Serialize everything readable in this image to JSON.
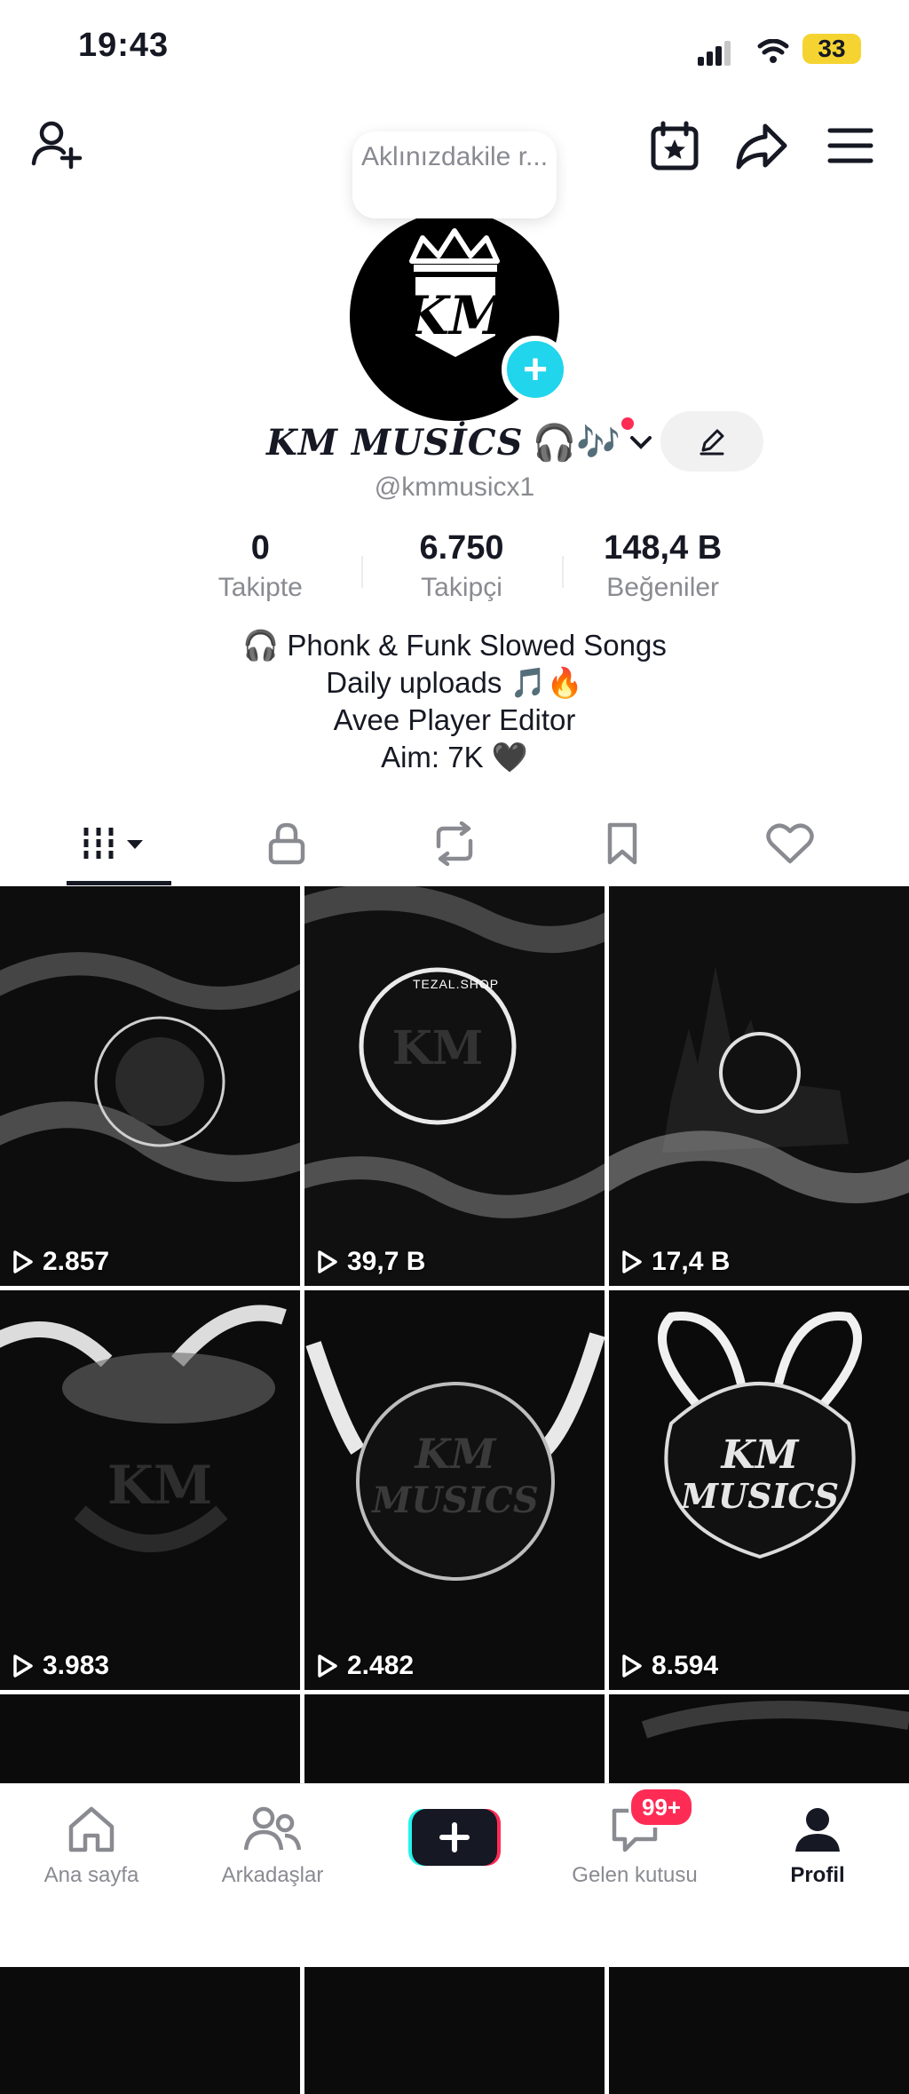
{
  "status_bar": {
    "time": "19:43",
    "battery": "33"
  },
  "bubble": {
    "text": "Aklınızdakile r..."
  },
  "profile": {
    "display_name": "KM MUSİCS",
    "name_emoji": "🎧🎶",
    "handle": "@kmmusicx1",
    "avatar_text": "KM"
  },
  "stats": [
    {
      "value": "0",
      "label": "Takipte"
    },
    {
      "value": "6.750",
      "label": "Takipçi"
    },
    {
      "value": "148,4 B",
      "label": "Beğeniler"
    }
  ],
  "bio": {
    "line1": "🎧 Phonk & Funk Slowed Songs",
    "line2": "Daily uploads 🎵🔥",
    "line3": "Avee Player Editor",
    "line4": "Aim: 7K 🖤"
  },
  "videos": [
    {
      "views": "2.857"
    },
    {
      "views": "39,7 B"
    },
    {
      "views": "17,4 B"
    },
    {
      "views": "3.983"
    },
    {
      "views": "2.482"
    },
    {
      "views": "8.594"
    }
  ],
  "watermark": "TEZAL.SHOP",
  "nav": {
    "home": "Ana sayfa",
    "friends": "Arkadaşlar",
    "inbox": "Gelen kutusu",
    "inbox_badge": "99+",
    "profile": "Profil"
  }
}
